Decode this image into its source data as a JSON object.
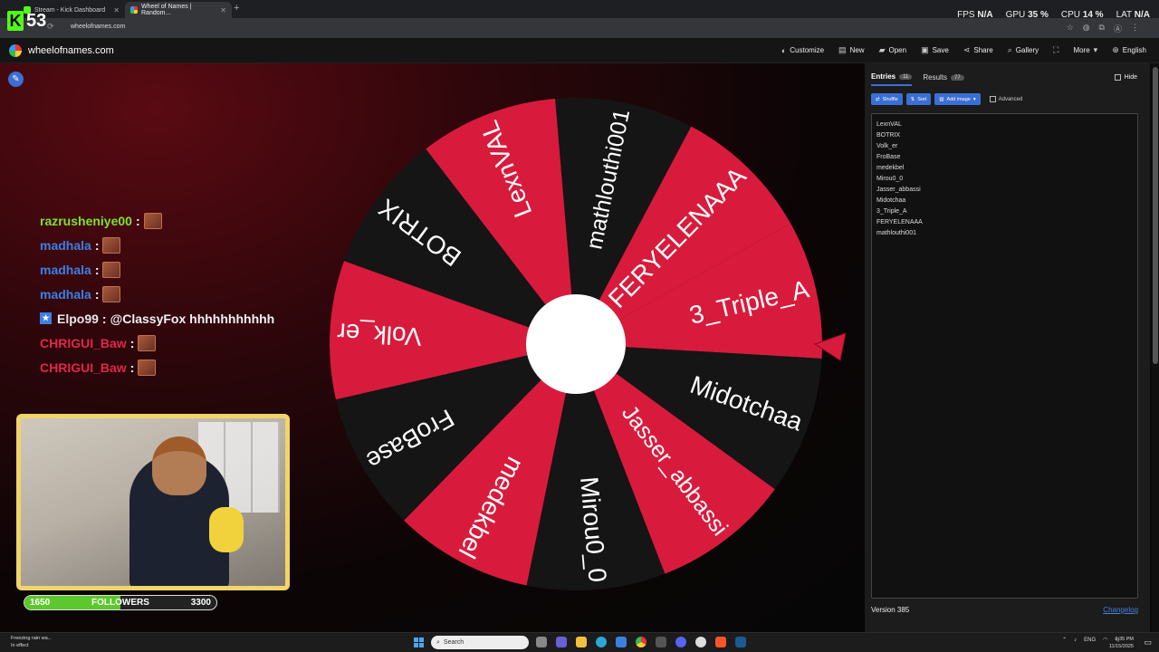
{
  "browser": {
    "tabs": [
      {
        "title": "Stream - Kick Dashboard",
        "favicon_color": "#53fc18",
        "active": false
      },
      {
        "title": "Wheel of Names | Random...",
        "favicon_color": "#e33333",
        "active": true
      }
    ],
    "url": "wheelofnames.com"
  },
  "kick_overlay": {
    "logo_letter": "K",
    "viewer_count": "53"
  },
  "perf": {
    "fps_label": "FPS",
    "fps": "N/A",
    "gpu_label": "GPU",
    "gpu": "35 %",
    "cpu_label": "CPU",
    "cpu": "14 %",
    "lat_label": "LAT",
    "lat": "N/A"
  },
  "site": {
    "name": "wheelofnames.com",
    "menu": [
      {
        "label": "Customize",
        "icon": "palette-icon"
      },
      {
        "label": "New",
        "icon": "file-icon"
      },
      {
        "label": "Open",
        "icon": "folder-icon"
      },
      {
        "label": "Save",
        "icon": "save-icon"
      },
      {
        "label": "Share",
        "icon": "share-icon"
      },
      {
        "label": "Gallery",
        "icon": "search-icon"
      },
      {
        "label": "",
        "icon": "fullscreen-icon"
      },
      {
        "label": "More",
        "icon": "chevron-down-icon"
      },
      {
        "label": "English",
        "icon": "globe-icon"
      }
    ]
  },
  "wheel": {
    "colors": {
      "red": "#d81b3c",
      "black": "#151515",
      "hub": "#ffffff"
    },
    "segments": [
      "3_Triple_A",
      "Midotchaa",
      "Jasser_abbassi",
      "Mirou0_0",
      "medekbel",
      "FroBase",
      "Volk_er",
      "BOTRIX",
      "LexnVAL",
      "mathlouthi001",
      "FERYELENAAA"
    ]
  },
  "chat": [
    {
      "user": "razrusheniye00",
      "color": "green",
      "message": "",
      "emote": true,
      "badge": false
    },
    {
      "user": "madhala",
      "color": "blue",
      "message": "",
      "emote": true,
      "badge": false
    },
    {
      "user": "madhala",
      "color": "blue",
      "message": "",
      "emote": true,
      "badge": false
    },
    {
      "user": "madhala",
      "color": "blue",
      "message": "",
      "emote": true,
      "badge": false
    },
    {
      "user": "Elpo99",
      "color": "white",
      "message": "@ClassyFox hhhhhhhhhhh",
      "emote": false,
      "badge": true
    },
    {
      "user": "CHRIGUI_Baw",
      "color": "red",
      "message": "",
      "emote": true,
      "badge": false
    },
    {
      "user": "CHRIGUI_Baw",
      "color": "red",
      "message": "",
      "emote": true,
      "badge": false
    }
  ],
  "followers": {
    "current": "1650",
    "label": "FOLLOWERS",
    "goal": "3300",
    "progress": 0.5
  },
  "panel": {
    "tabs": [
      {
        "label": "Entries",
        "count": "11",
        "active": true
      },
      {
        "label": "Results",
        "count": "77",
        "active": false
      }
    ],
    "hide_label": "Hide",
    "tools": {
      "shuffle": "Shuffle",
      "sort": "Sort",
      "add_image": "Add image",
      "advanced": "Advanced"
    },
    "entries": [
      "LexnVAL",
      "BOTRIX",
      "Volk_er",
      "FroBase",
      "medekbel",
      "Mirou0_0",
      "Jasser_abbassi",
      "Midotchaa",
      "3_Triple_A",
      "FERYELENAAA",
      "mathlouthi001"
    ],
    "version": "Version 385",
    "changelog": "Changelog"
  },
  "taskbar": {
    "weather_line1": "Freezing rain wa...",
    "weather_line2": "In effect",
    "search_placeholder": "Search",
    "lang": "ENG",
    "time": "6:35 PM",
    "date": "11/15/2025"
  }
}
